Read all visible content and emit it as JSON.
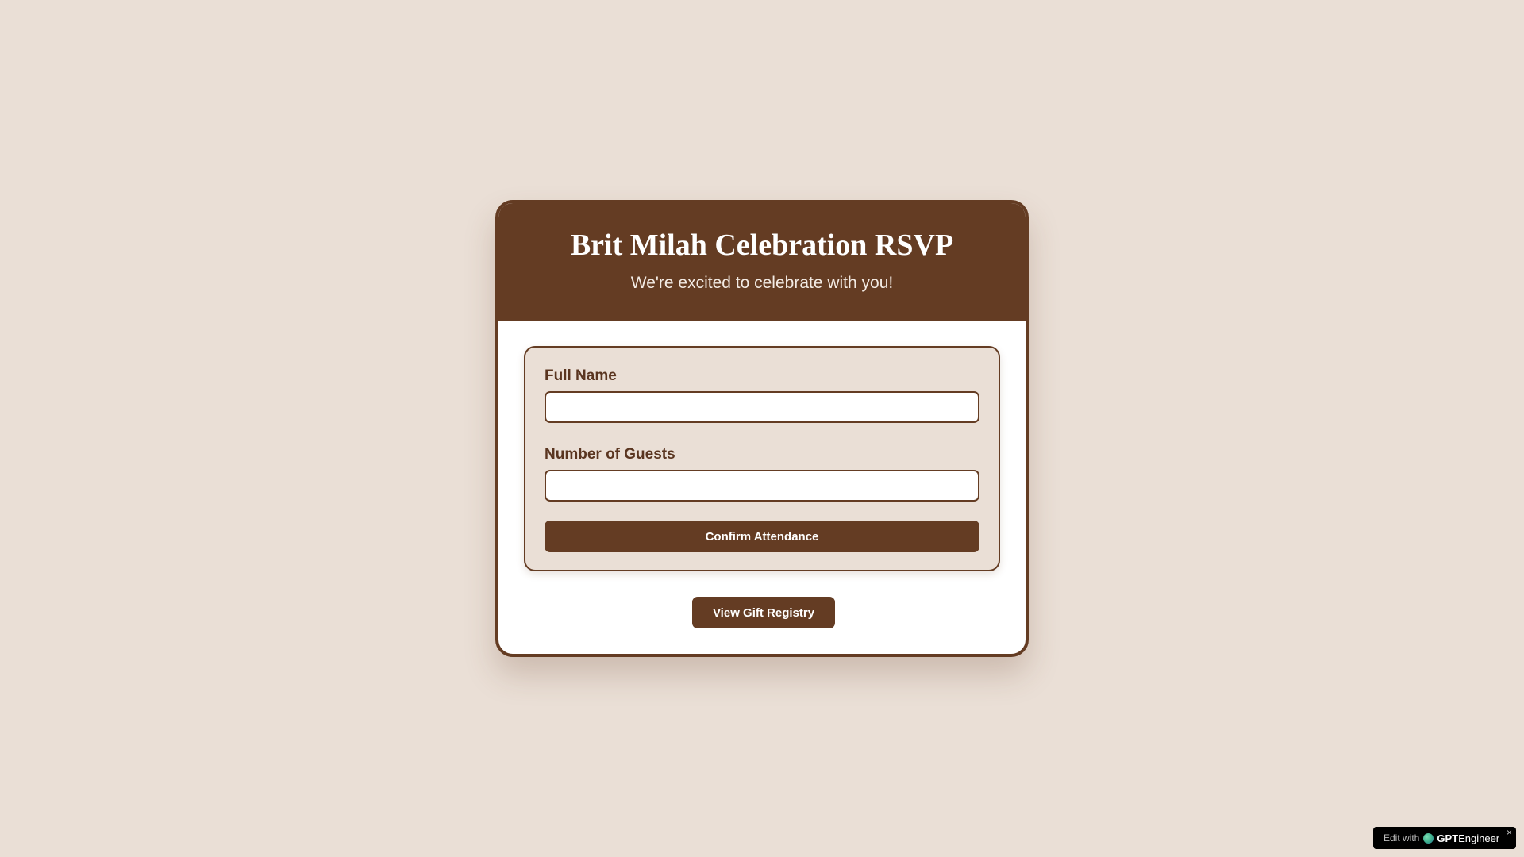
{
  "header": {
    "title": "Brit Milah Celebration RSVP",
    "subtitle": "We're excited to celebrate with you!"
  },
  "form": {
    "full_name_label": "Full Name",
    "full_name_value": "",
    "guests_label": "Number of Guests",
    "guests_value": "",
    "confirm_label": "Confirm Attendance"
  },
  "registry": {
    "label": "View Gift Registry"
  },
  "badge": {
    "edit_text": "Edit with",
    "brand_strong": "GPT",
    "brand_rest": "Engineer",
    "close_glyph": "×"
  },
  "colors": {
    "background": "#eadfd6",
    "brand_brown": "#643c23",
    "card": "#ffffff"
  }
}
